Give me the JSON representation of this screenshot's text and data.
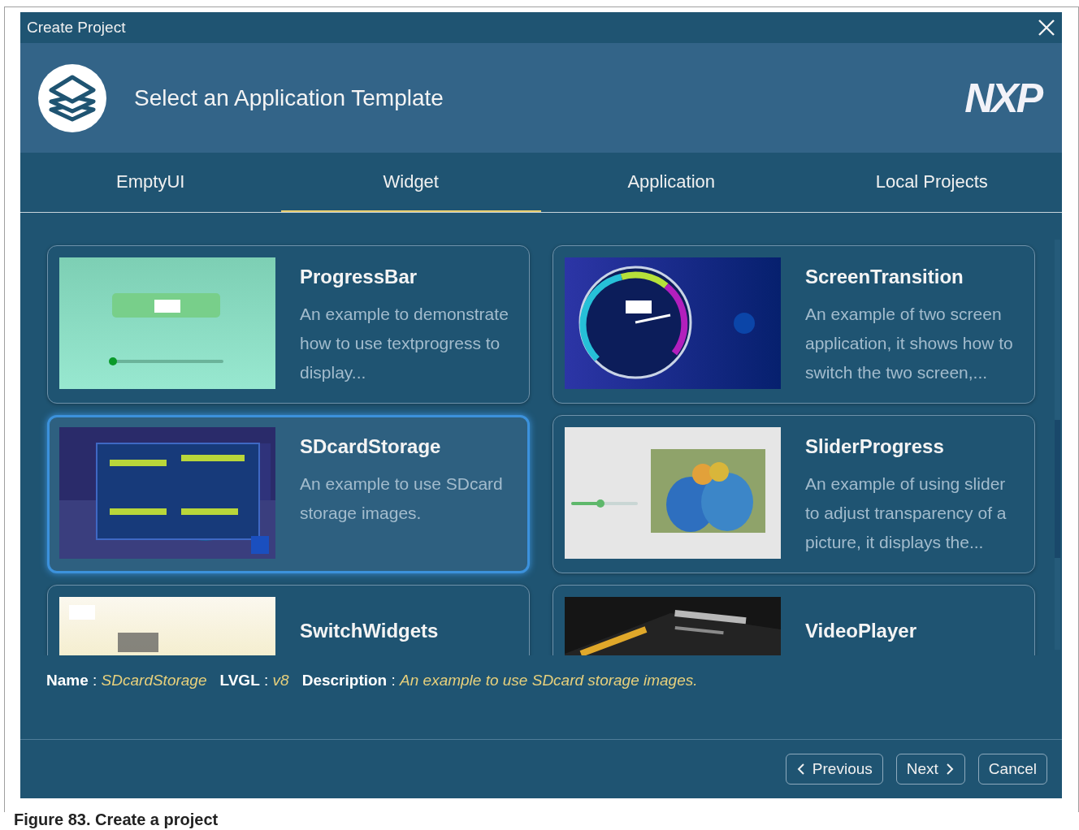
{
  "window": {
    "title": "Create Project"
  },
  "header": {
    "title": "Select an Application Template",
    "logo": "NXP"
  },
  "tabs": [
    {
      "label": "EmptyUI",
      "selected": false
    },
    {
      "label": "Widget",
      "selected": true
    },
    {
      "label": "Application",
      "selected": false
    },
    {
      "label": "Local Projects",
      "selected": false
    }
  ],
  "templates": [
    {
      "name": "ProgressBar",
      "description": "An example to demonstrate how to use textprogress to display...",
      "selected": false,
      "kind": "picture"
    },
    {
      "name": "ScreenTransition",
      "description": "An example of two screen application, it shows how to switch the two screen,...",
      "selected": false,
      "kind": "picture"
    },
    {
      "name": "SDcardStorage",
      "description": "An example to use SDcard storage images.",
      "selected": true,
      "kind": "picture"
    },
    {
      "name": "SliderProgress",
      "description": "An example of using slider to adjust transparency of a picture, it displays the...",
      "selected": false,
      "kind": "picture"
    },
    {
      "name": "SwitchWidgets",
      "selected": false,
      "kind": "picture"
    },
    {
      "name": "VideoPlayer",
      "selected": false,
      "kind": "picture"
    }
  ],
  "info": [
    {
      "label": "Name",
      "separator": ":",
      "value": "SDcardStorage"
    },
    {
      "label": "LVGL",
      "separator": ":",
      "value": "v8"
    },
    {
      "label": "Description",
      "separator": ":",
      "value": "An example to use SDcard storage images."
    }
  ],
  "buttons": [
    {
      "label": "Previous",
      "kind": "back"
    },
    {
      "label": "Next",
      "kind": "forward"
    },
    {
      "label": "Cancel",
      "kind": "plain"
    }
  ],
  "caption": "Figure 83.  Create a project"
}
